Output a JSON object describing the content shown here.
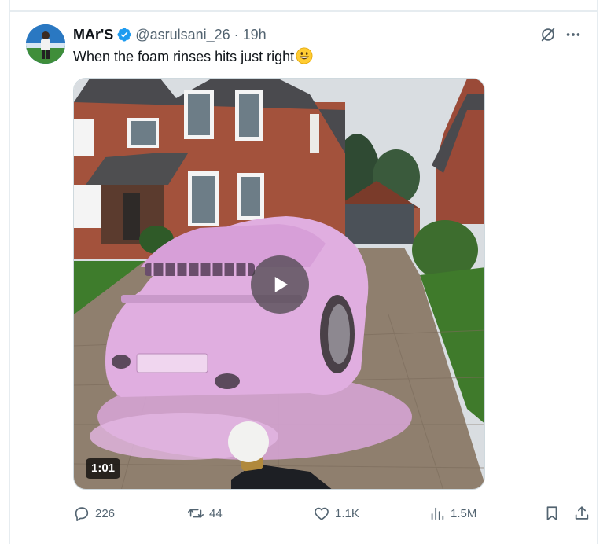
{
  "post": {
    "display_name": "MAr'S",
    "handle": "@asrulsani_26",
    "separator": "·",
    "time": "19h",
    "text": "When the foam rinses hits just right",
    "media": {
      "type": "video",
      "duration": "1:01"
    },
    "actions": {
      "replies": "226",
      "reposts": "44",
      "likes": "1.1K",
      "views": "1.5M"
    }
  },
  "colors": {
    "verified_blue": "#1d9bf0",
    "secondary_text": "#536471",
    "foam_pink": "#e0aee0"
  },
  "icons": [
    "verified-badge-icon",
    "grok-icon",
    "more-icon",
    "play-icon",
    "reply-icon",
    "repost-icon",
    "like-icon",
    "views-icon",
    "bookmark-icon",
    "share-icon"
  ]
}
